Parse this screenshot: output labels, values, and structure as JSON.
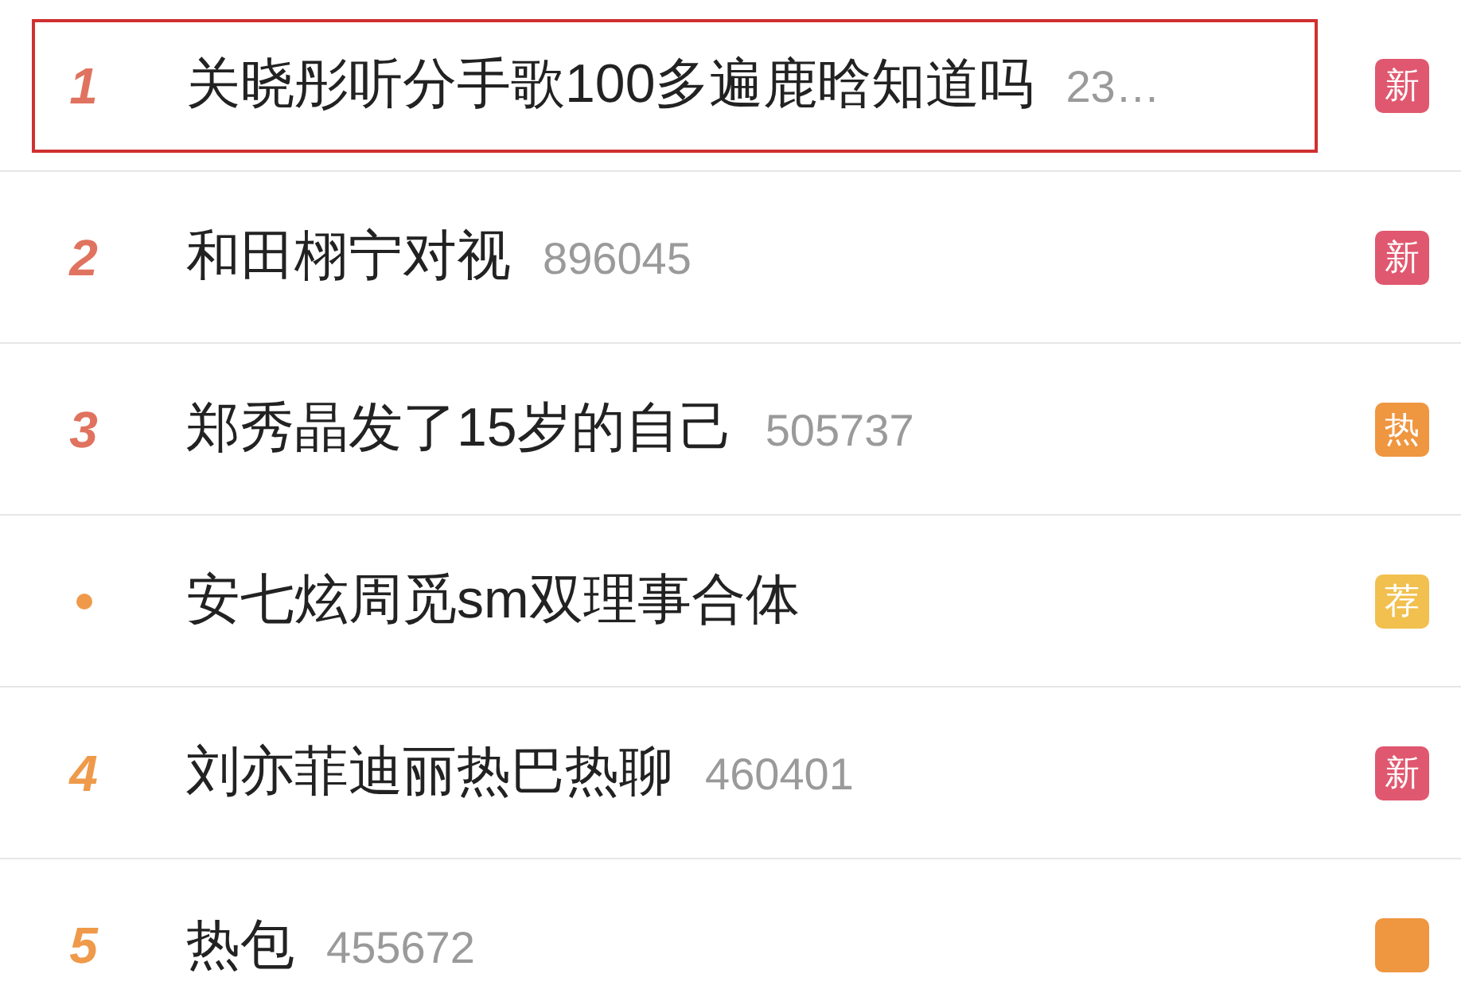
{
  "hot_list": [
    {
      "kind": "rank",
      "rank": "1",
      "color": "#e0735f",
      "title": "关晓彤听分手歌100多遍鹿晗知道吗",
      "count": "23…",
      "badge": {
        "kind": "new",
        "text": "新"
      },
      "highlighted": true
    },
    {
      "kind": "rank",
      "rank": "2",
      "color": "#e0735f",
      "title": "和田栩宁对视",
      "count": "896045",
      "badge": {
        "kind": "new",
        "text": "新"
      },
      "highlighted": false
    },
    {
      "kind": "rank",
      "rank": "3",
      "color": "#e0735f",
      "title": "郑秀晶发了15岁的自己",
      "count": "505737",
      "badge": {
        "kind": "hot",
        "text": "热"
      },
      "highlighted": false
    },
    {
      "kind": "dot",
      "color": "#ef9a4a",
      "title": "安七炫周觅sm双理事合体",
      "badge": {
        "kind": "recommend",
        "text": "荐"
      },
      "highlighted": false
    },
    {
      "kind": "rank",
      "rank": "4",
      "color": "#ef9a4a",
      "title": "刘亦菲迪丽热巴热聊",
      "count": "460401",
      "badge": {
        "kind": "new",
        "text": "新"
      },
      "highlighted": false
    },
    {
      "kind": "rank",
      "rank": "5",
      "color": "#ef9a4a",
      "title": "热包",
      "count": "455672",
      "badge": {
        "kind": "hot"
      },
      "highlighted": false
    }
  ]
}
